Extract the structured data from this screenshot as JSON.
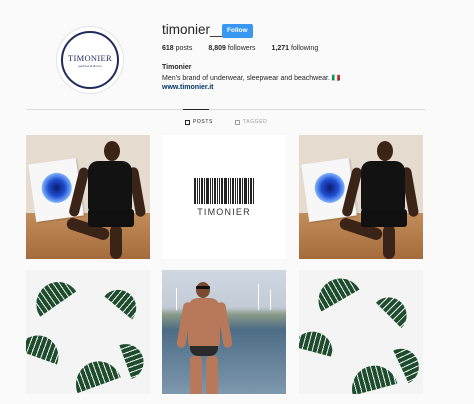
{
  "profile": {
    "avatar_brand": "TIMONIER",
    "avatar_tagline": "qualcosa di diverso",
    "username": "timonier__",
    "follow_label": "Follow",
    "stats": {
      "posts_count": "618",
      "posts_label": "posts",
      "followers_count": "8,809",
      "followers_label": "followers",
      "following_count": "1,271",
      "following_label": "following"
    },
    "bio_name": "Timonier",
    "bio_text": "Men's brand of underwear, sleepwear and beachwear. 🇮🇹",
    "bio_link": "www.timonier.it"
  },
  "tabs": [
    {
      "label": "POSTS",
      "icon": "grid-icon",
      "active": true
    },
    {
      "label": "TAGGED",
      "icon": "tag-icon",
      "active": false
    }
  ],
  "grid": {
    "barcode_brand": "TIMONIER",
    "posts": [
      {
        "kind": "photo",
        "subject": "man-in-black-underwear-on-floor"
      },
      {
        "kind": "graphic",
        "subject": "timonier-barcode-logo"
      },
      {
        "kind": "photo",
        "subject": "man-in-black-underwear-on-floor"
      },
      {
        "kind": "pattern",
        "subject": "tropical-leaves"
      },
      {
        "kind": "photo",
        "subject": "man-in-swim-briefs-at-marina"
      },
      {
        "kind": "pattern",
        "subject": "tropical-leaves"
      }
    ]
  },
  "colors": {
    "follow_button": "#3897f0",
    "brand_navy": "#1f2b5c",
    "link": "#003569",
    "background": "#fafafa"
  }
}
